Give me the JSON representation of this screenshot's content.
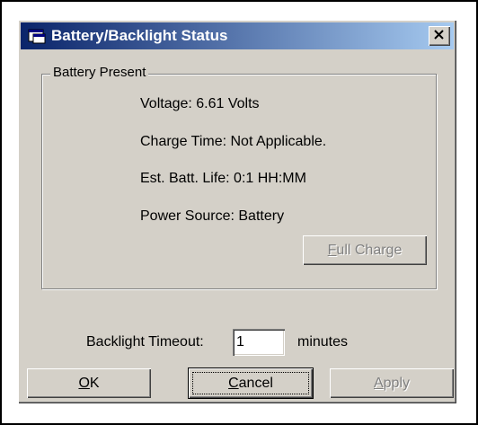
{
  "dialog": {
    "title": "Battery/Backlight Status",
    "close_glyph": "×"
  },
  "group": {
    "label": "Battery Present",
    "voltage": "Voltage: 6.61 Volts",
    "charge_time": "Charge Time: Not Applicable.",
    "batt_life": "Est. Batt. Life: 0:1  HH:MM",
    "power_source": "Power Source: Battery",
    "full_charge_button": {
      "mnemonic": "F",
      "rest": "ull Charge",
      "enabled": false
    }
  },
  "backlight": {
    "label": "Backlight Timeout:",
    "value": "1",
    "unit": "minutes"
  },
  "buttons": {
    "ok": {
      "mnemonic": "O",
      "rest": "K"
    },
    "cancel": {
      "mnemonic": "C",
      "rest": "ancel"
    },
    "apply": {
      "mnemonic": "A",
      "rest": "pply",
      "enabled": false
    }
  },
  "colors": {
    "dialog_face": "#d4d0c8",
    "titlebar_start": "#0a246a",
    "titlebar_end": "#a6caf0",
    "disabled_text": "#808080"
  },
  "icons": {
    "title": "window-app-icon",
    "close": "close-icon"
  }
}
